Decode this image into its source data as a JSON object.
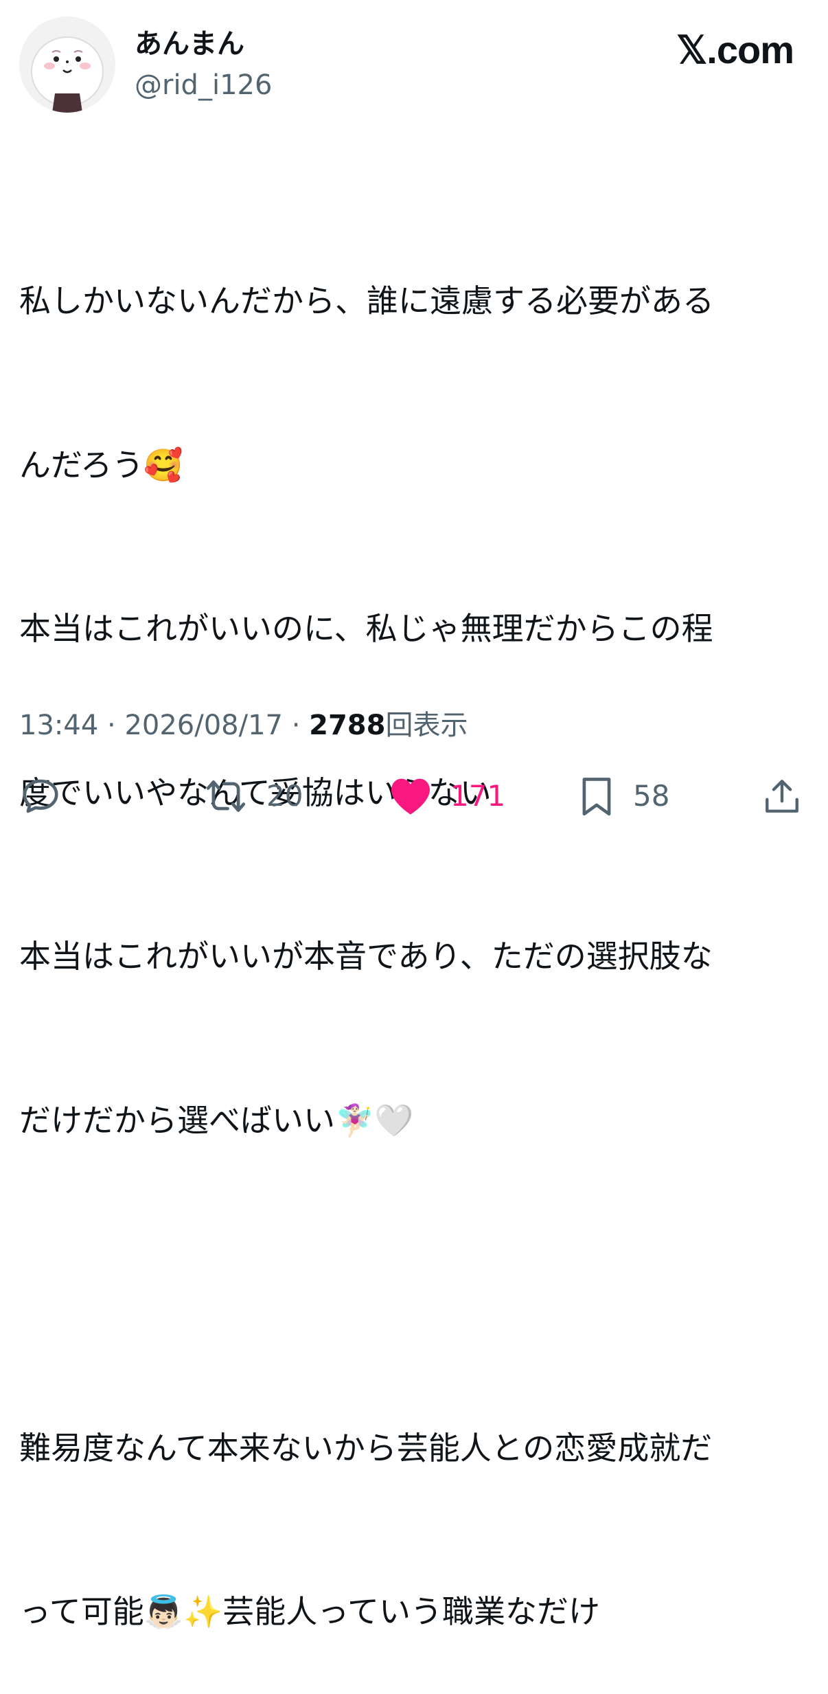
{
  "user": {
    "display_name": "あんまん",
    "handle": "@rid_i126"
  },
  "brand": {
    "logo_text": "𝕏.com"
  },
  "tweet": {
    "lines": [
      "私しかいないんだから、誰に遠慮する必要がある",
      "んだろう🥰",
      "本当はこれがいいのに、私じゃ無理だからこの程",
      "度でいいやなんて妥協はいらない",
      "本当はこれがいいが本音であり、ただの選択肢な",
      "だけだから選べばいい🧚🏻‍♀️🤍",
      "",
      "難易度なんて本来ないから芸能人との恋愛成就だ",
      "って可能👼🏻✨芸能人っていう職業なだけ"
    ]
  },
  "meta": {
    "time": "13:44",
    "separator1": " · ",
    "date": "2026/08/17",
    "separator2": " · ",
    "views_count": "2788",
    "views_label": "回表示"
  },
  "actions": {
    "reply_icon": "reply-icon",
    "retweet_icon": "retweet-icon",
    "retweet_count": "20",
    "like_icon": "heart-icon",
    "like_count": "171",
    "bookmark_icon": "bookmark-icon",
    "bookmark_count": "58",
    "share_icon": "share-icon"
  },
  "colors": {
    "text_primary": "#0f1419",
    "text_secondary": "#536471",
    "like_active": "#f91880"
  }
}
